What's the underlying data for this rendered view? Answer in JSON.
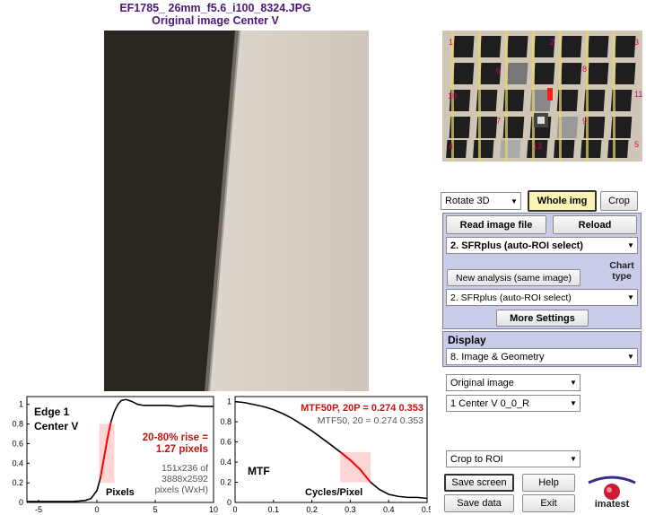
{
  "header": {
    "filename": "EF1785_ 26mm_f5.6_i100_8324.JPG",
    "subtitle": "Original image   Center  V"
  },
  "chart_thumb": {
    "labels": [
      "1",
      "2",
      "3",
      "6",
      "8",
      "10",
      "11",
      "7",
      "9",
      "4",
      "13",
      "5"
    ]
  },
  "controls": {
    "rotate": "Rotate 3D",
    "whole_img": "Whole img",
    "crop": "Crop",
    "read_image": "Read image file",
    "reload": "Reload",
    "analysis_select": "2. SFRplus (auto-ROI select)",
    "new_analysis": "New analysis (same image)",
    "chart_type_label": "Chart type",
    "chart_type_select": "2. SFRplus (auto-ROI select)",
    "more_settings": "More Settings",
    "display_label": "Display",
    "display_select": "8.   Image & Geometry",
    "image_select": "Original image",
    "roi_select": "1  Center  V     0_0_R",
    "crop_select": "Crop to ROI",
    "save_screen": "Save screen",
    "help": "Help",
    "save_data": "Save data",
    "exit": "Exit",
    "logo_text": "imatest"
  },
  "edge_plot": {
    "title1": "Edge 1",
    "title2": "Center  V",
    "rise_line1": "20-80% rise =",
    "rise_line2": "1.27 pixels",
    "info1": "151x236 of",
    "info2": "3888x2592",
    "info3": "pixels (WxH)",
    "xlabel": "Pixels",
    "xticks": [
      "-5",
      "0",
      "5",
      "10"
    ],
    "yticks": [
      "0",
      "0.2",
      "0.4",
      "0.6",
      "0.8",
      "1"
    ]
  },
  "mtf_plot": {
    "title_red": "MTF50P, 20P = 0.274  0.353",
    "title_gray": "MTF50, 20  =  0.274  0.353",
    "label": "MTF",
    "xlabel": "Cycles/Pixel",
    "xticks": [
      "0",
      "0.1",
      "0.2",
      "0.3",
      "0.4",
      "0.5"
    ],
    "yticks": [
      "0",
      "0.2",
      "0.4",
      "0.6",
      "0.8",
      "1"
    ]
  },
  "chart_data": [
    {
      "type": "line",
      "title": "Edge 1 Center V",
      "xlabel": "Pixels",
      "xlim": [
        -6,
        10
      ],
      "ylim": [
        0,
        1.08
      ],
      "series": [
        {
          "x": [
            -6,
            -5,
            -4,
            -3,
            -2,
            -1,
            -0.5,
            0,
            0.3,
            0.6,
            0.9,
            1.2,
            1.5,
            1.8,
            2.1,
            2.5,
            3,
            3.5,
            4,
            5,
            6,
            7,
            8,
            9,
            10
          ],
          "y": [
            0.01,
            0.01,
            0.01,
            0.01,
            0.01,
            0.02,
            0.04,
            0.12,
            0.25,
            0.45,
            0.65,
            0.82,
            0.93,
            1.0,
            1.04,
            1.05,
            1.03,
            1.0,
            0.99,
            0.99,
            0.99,
            0.98,
            0.99,
            0.98,
            0.98
          ]
        }
      ],
      "annotations": [
        "20-80% rise = 1.27 pixels",
        "151x236 of 3888x2592 pixels (WxH)"
      ]
    },
    {
      "type": "line",
      "title": "MTF50P, 20P = 0.274  0.353",
      "xlabel": "Cycles/Pixel",
      "xlim": [
        0,
        0.5
      ],
      "ylim": [
        0,
        1.05
      ],
      "series": [
        {
          "x": [
            0,
            0.025,
            0.05,
            0.075,
            0.1,
            0.125,
            0.15,
            0.175,
            0.2,
            0.225,
            0.25,
            0.274,
            0.3,
            0.325,
            0.353,
            0.375,
            0.4,
            0.425,
            0.45,
            0.475,
            0.5
          ],
          "y": [
            1.0,
            0.99,
            0.97,
            0.95,
            0.92,
            0.88,
            0.83,
            0.77,
            0.71,
            0.64,
            0.57,
            0.5,
            0.42,
            0.33,
            0.2,
            0.13,
            0.08,
            0.06,
            0.05,
            0.05,
            0.04
          ]
        }
      ],
      "annotations": [
        "MTF50, 20 = 0.274 0.353"
      ]
    }
  ]
}
